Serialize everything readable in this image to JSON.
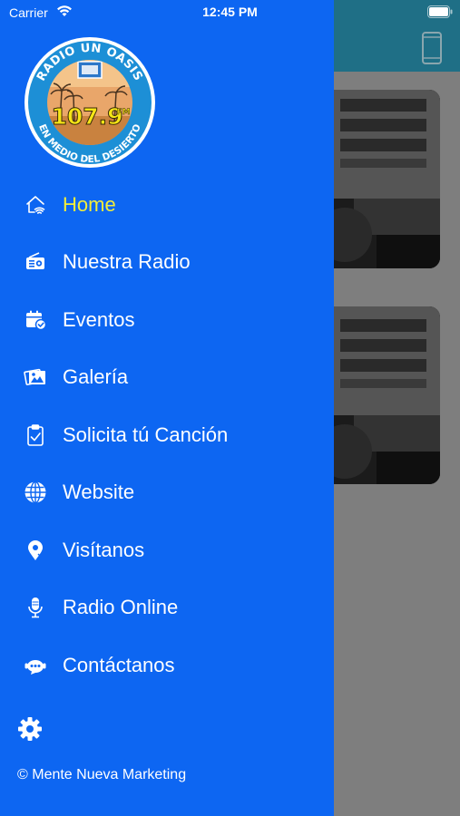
{
  "status_bar": {
    "carrier": "Carrier",
    "time": "12:45 PM"
  },
  "logo": {
    "top_text": "RADIO UN OASIS",
    "frequency": "107.9",
    "band": "FM",
    "bottom_text": "EN MEDIO DEL DESIERTO"
  },
  "menu": {
    "items": [
      {
        "label": "Home",
        "icon": "home-wifi-icon",
        "active": true
      },
      {
        "label": "Nuestra Radio",
        "icon": "radio-icon"
      },
      {
        "label": "Eventos",
        "icon": "calendar-check-icon"
      },
      {
        "label": "Galería",
        "icon": "gallery-icon"
      },
      {
        "label": "Solicita tú Canción",
        "icon": "clipboard-check-icon"
      },
      {
        "label": "Website",
        "icon": "globe-icon"
      },
      {
        "label": "Visítanos",
        "icon": "map-pin-icon"
      },
      {
        "label": "Radio Online",
        "icon": "microphone-icon"
      },
      {
        "label": "Contáctanos",
        "icon": "chat-bubble-icon"
      }
    ]
  },
  "footer": {
    "copyright": "© Mente Nueva Marketing"
  },
  "colors": {
    "drawer_bg": "#0d66f2",
    "active_label": "#f2ed3a",
    "header_bg": "#1f6f86",
    "overlay_bg": "#7e7e7e"
  }
}
